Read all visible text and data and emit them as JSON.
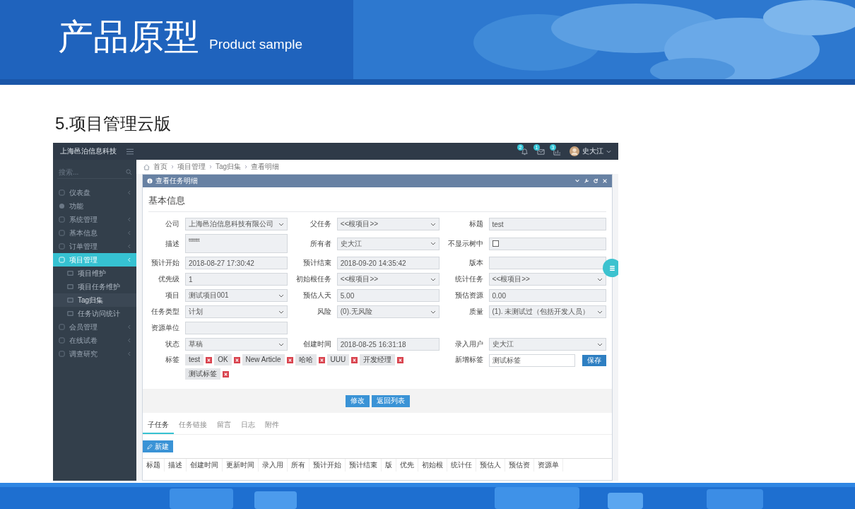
{
  "slide": {
    "title": "产品原型",
    "subtitle": "Product sample",
    "heading": "5.项目管理云版"
  },
  "app": {
    "brand": "上海邑泊信息科技",
    "notifications": [
      {
        "kind": "bell",
        "count": "2"
      },
      {
        "kind": "envelope",
        "count": "1"
      },
      {
        "kind": "chart",
        "count": "3"
      }
    ],
    "user": "史大江",
    "sidebar": {
      "search_placeholder": "搜索...",
      "items": [
        {
          "kind": "item",
          "label": "仪表盘",
          "selected": false
        },
        {
          "kind": "header",
          "label": "功能"
        },
        {
          "kind": "item",
          "label": "系统管理",
          "selected": false
        },
        {
          "kind": "item",
          "label": "基本信息",
          "selected": false
        },
        {
          "kind": "item",
          "label": "订单管理",
          "selected": false
        },
        {
          "kind": "item",
          "label": "项目管理",
          "selected": true,
          "children": [
            {
              "label": "项目维护",
              "selected": false
            },
            {
              "label": "项目任务维护",
              "selected": false
            },
            {
              "label": "Tag归集",
              "selected": true
            },
            {
              "label": "任务访问统计",
              "selected": false
            }
          ]
        },
        {
          "kind": "item",
          "label": "会员管理",
          "selected": false
        },
        {
          "kind": "item",
          "label": "在线试卷",
          "selected": false
        },
        {
          "kind": "item",
          "label": "调查研究",
          "selected": false
        }
      ]
    },
    "breadcrumb": [
      "首页",
      "项目管理",
      "Tag归集",
      "查看明细"
    ],
    "panel": {
      "title": "查看任务明细",
      "section": "基本信息",
      "rows": [
        [
          {
            "label": "公司",
            "kind": "select",
            "value": "上海邑泊信息科技有限公司"
          },
          {
            "label": "父任务",
            "kind": "select",
            "value": "<<根项目>>"
          },
          {
            "label": "标题",
            "kind": "input",
            "value": "test"
          }
        ],
        [
          {
            "label": "描述",
            "kind": "textarea",
            "value": "ttttttt"
          },
          {
            "label": "所有者",
            "kind": "select",
            "value": "史大江"
          },
          {
            "label": "不显示树中",
            "kind": "checkbox",
            "checked": false
          }
        ],
        [
          {
            "label": "预计开始",
            "kind": "input",
            "value": "2018-08-27 17:30:42"
          },
          {
            "label": "预计结束",
            "kind": "input",
            "value": "2018-09-20 14:35:42"
          },
          {
            "label": "版本",
            "kind": "input"
          }
        ],
        [
          {
            "label": "优先级",
            "kind": "input",
            "value": "1"
          },
          {
            "label": "初始根任务",
            "kind": "select",
            "value": "<<根项目>>"
          },
          {
            "label": "统计任务",
            "kind": "select",
            "value": "<<根项目>>"
          }
        ],
        [
          {
            "label": "项目",
            "kind": "select",
            "value": "测试项目001"
          },
          {
            "label": "预估人天",
            "kind": "input",
            "value": "5.00"
          },
          {
            "label": "预估资源",
            "kind": "input",
            "value": "0.00"
          }
        ],
        [
          {
            "label": "任务类型",
            "kind": "select",
            "value": "计划"
          },
          {
            "label": "风险",
            "kind": "select",
            "value": "(0).无风险"
          },
          {
            "label": "质量",
            "kind": "select",
            "value": "(1). 未测试过（包括开发人员）"
          }
        ],
        [
          {
            "label": "资源单位",
            "kind": "input"
          }
        ],
        [
          {
            "label": "状态",
            "kind": "select",
            "value": "草稿"
          },
          {
            "label": "创建时间",
            "kind": "input",
            "value": "2018-08-25 16:31:18"
          },
          {
            "label": "录入用户",
            "kind": "select",
            "value": "史大江"
          }
        ]
      ],
      "tags_label": "标签",
      "tags": [
        "test",
        "OK",
        "New Article",
        "哈哈",
        "UUU",
        "开发经理",
        "测试标签"
      ],
      "new_tag": {
        "label": "新增标签",
        "value": "测试标签",
        "button": "保存"
      },
      "buttons": [
        "修改",
        "返回列表"
      ]
    },
    "tabs": [
      {
        "label": "子任务",
        "selected": true
      },
      {
        "label": "任务链接",
        "selected": false
      },
      {
        "label": "留言",
        "selected": false
      },
      {
        "label": "日志",
        "selected": false
      },
      {
        "label": "附件",
        "selected": false
      }
    ],
    "new_button": "新建",
    "table": {
      "columns": [
        "标题",
        "描述",
        "创建时间",
        "更新时间",
        "录入用",
        "所有",
        "预计开始",
        "预计结束",
        "版",
        "优先",
        "初始根",
        "统计任",
        "预估人",
        "预估资",
        "资源单"
      ]
    }
  }
}
